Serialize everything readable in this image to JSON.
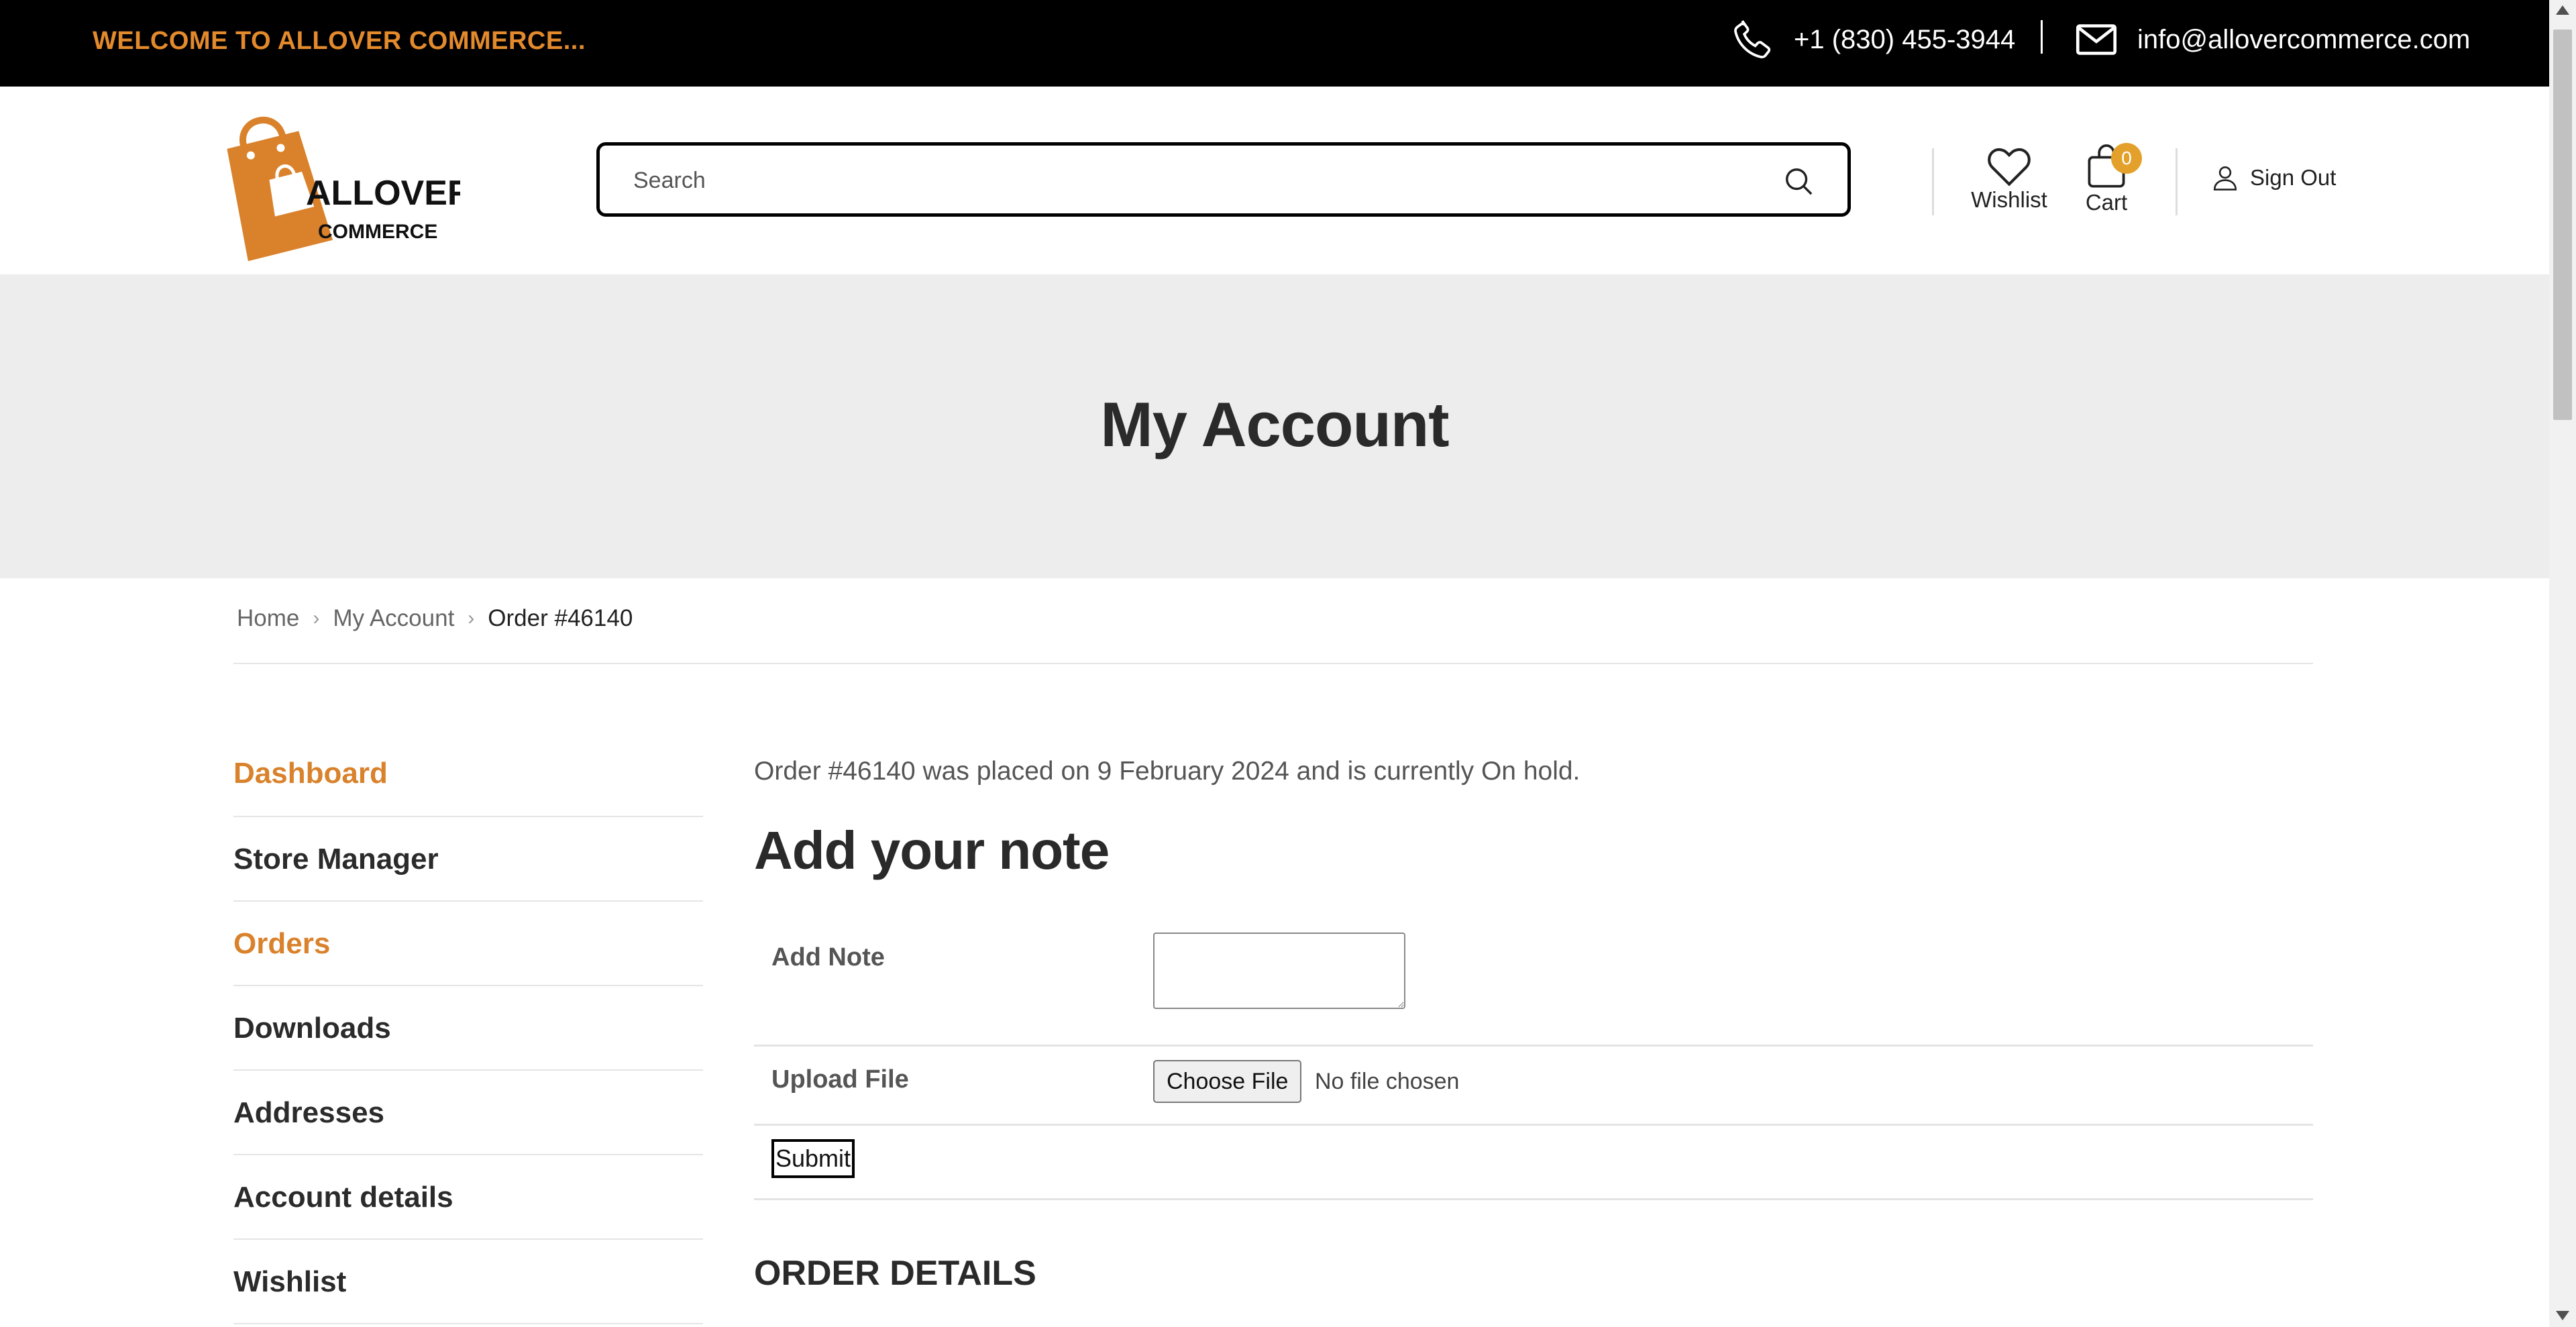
{
  "topbar": {
    "welcome": "WELCOME TO ALLOVER COMMERCE...",
    "phone": "+1 (830) 455-3944",
    "email": "info@allovercommerce.com",
    "phone_icon": "phone-icon",
    "email_icon": "envelope-icon"
  },
  "header": {
    "logo_line1": "ALLOVER",
    "logo_line2": "COMMERCE",
    "search_placeholder": "Search",
    "wishlist_label": "Wishlist",
    "cart_label": "Cart",
    "cart_count": "0",
    "signout_label": "Sign Out"
  },
  "hero": {
    "title": "My Account"
  },
  "breadcrumb": {
    "home": "Home",
    "account": "My Account",
    "current": "Order #46140"
  },
  "sidebar": {
    "items": [
      {
        "label": "Dashboard",
        "active": true
      },
      {
        "label": "Store Manager"
      },
      {
        "label": "Orders",
        "active": true
      },
      {
        "label": "Downloads"
      },
      {
        "label": "Addresses"
      },
      {
        "label": "Account details"
      },
      {
        "label": "Wishlist"
      }
    ]
  },
  "main": {
    "order_message": "Order #46140 was placed on 9 February 2024 and is currently On hold.",
    "note_title": "Add your note",
    "add_note_label": "Add Note",
    "note_value": "",
    "upload_label": "Upload File",
    "choose_file": "Choose File",
    "file_status": "No file chosen",
    "submit": "Submit",
    "details_title": "ORDER DETAILS"
  },
  "colors": {
    "accent": "#d9822b",
    "topbar_bg": "#000000",
    "hero_bg": "#ededed",
    "badge": "#e3a12c"
  }
}
